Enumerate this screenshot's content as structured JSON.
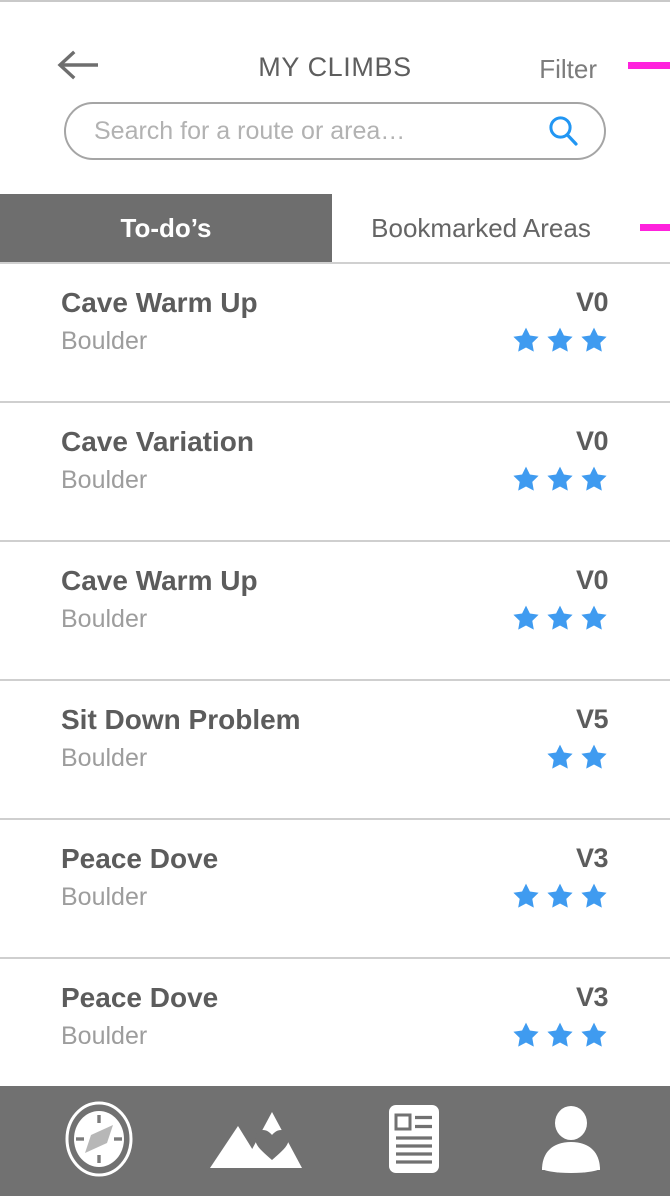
{
  "header": {
    "title": "MY CLIMBS",
    "back_icon": "arrow-left-icon",
    "filter_label": "Filter",
    "accent_color": "#ff22dd"
  },
  "search": {
    "placeholder": "Search for a route or area…",
    "value": "",
    "icon": "search-icon",
    "icon_color": "#2196f3"
  },
  "tabs": [
    {
      "label": "To-do’s",
      "active": true
    },
    {
      "label": "Bookmarked Areas",
      "active": false
    }
  ],
  "list": {
    "star_color": "#3f9bf0",
    "rows": [
      {
        "title": "Cave Warm Up",
        "subtitle": "Boulder",
        "grade": "V0",
        "stars": 3
      },
      {
        "title": "Cave Variation",
        "subtitle": "Boulder",
        "grade": "V0",
        "stars": 3
      },
      {
        "title": "Cave Warm Up",
        "subtitle": "Boulder",
        "grade": "V0",
        "stars": 3
      },
      {
        "title": "Sit Down Problem",
        "subtitle": "Boulder",
        "grade": "V5",
        "stars": 2
      },
      {
        "title": "Peace Dove",
        "subtitle": "Boulder",
        "grade": "V3",
        "stars": 3
      },
      {
        "title": "Peace Dove",
        "subtitle": "Boulder",
        "grade": "V3",
        "stars": 3
      }
    ]
  },
  "bottom_nav": {
    "background": "#717171",
    "items": [
      {
        "icon": "compass-icon",
        "name": "explore"
      },
      {
        "icon": "mountain-heart-icon",
        "name": "favorites"
      },
      {
        "icon": "news-article-icon",
        "name": "feed"
      },
      {
        "icon": "person-icon",
        "name": "profile"
      }
    ]
  }
}
